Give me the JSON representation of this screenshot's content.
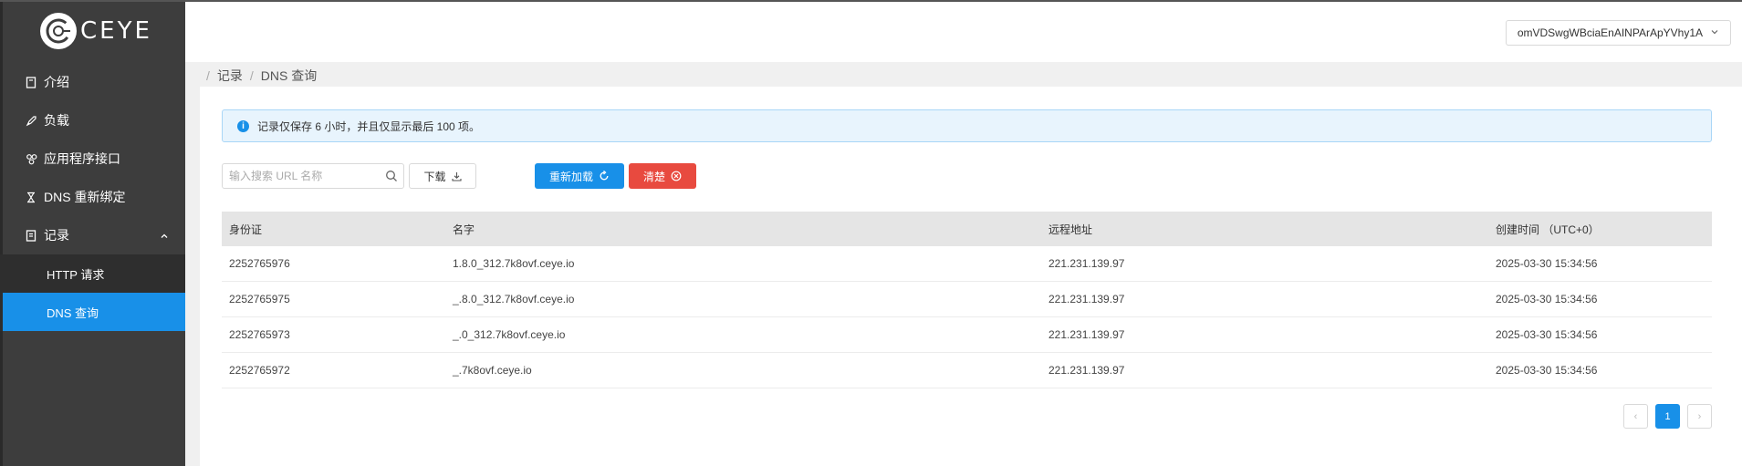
{
  "brand": {
    "name": "CEYE"
  },
  "sidebar": {
    "items": [
      {
        "label": "介绍",
        "icon": "book-icon"
      },
      {
        "label": "负载",
        "icon": "rocket-icon"
      },
      {
        "label": "应用程序接口",
        "icon": "api-icon"
      },
      {
        "label": "DNS 重新绑定",
        "icon": "hourglass-icon"
      },
      {
        "label": "记录",
        "icon": "list-icon",
        "expanded": true
      }
    ],
    "sub_items": [
      {
        "label": "HTTP 请求"
      },
      {
        "label": "DNS 查询",
        "active": true
      }
    ]
  },
  "header": {
    "account": "omVDSwgWBciaEnAINPArApYVhy1A"
  },
  "breadcrumb": {
    "root": "记录",
    "current": "DNS 查询"
  },
  "alert": {
    "text": "记录仅保存 6 小时，并且仅显示最后 100 项。"
  },
  "toolbar": {
    "search_placeholder": "输入搜索 URL 名称",
    "download_label": "下载",
    "reload_label": "重新加载",
    "clear_label": "清楚"
  },
  "table": {
    "columns": [
      "身份证",
      "名字",
      "远程地址",
      "创建时间 （UTC+0）"
    ],
    "rows": [
      [
        "2252765976",
        "1.8.0_312.7k8ovf.ceye.io",
        "221.231.139.97",
        "2025-03-30 15:34:56"
      ],
      [
        "2252765975",
        "_.8.0_312.7k8ovf.ceye.io",
        "221.231.139.97",
        "2025-03-30 15:34:56"
      ],
      [
        "2252765973",
        "_.0_312.7k8ovf.ceye.io",
        "221.231.139.97",
        "2025-03-30 15:34:56"
      ],
      [
        "2252765972",
        "_.7k8ovf.ceye.io",
        "221.231.139.97",
        "2025-03-30 15:34:56"
      ]
    ]
  },
  "pagination": {
    "current": "1",
    "prev": "‹",
    "next": "›"
  },
  "colors": {
    "primary": "#1890e8",
    "danger": "#e84a3f",
    "sidebar": "#3d3d3d"
  }
}
